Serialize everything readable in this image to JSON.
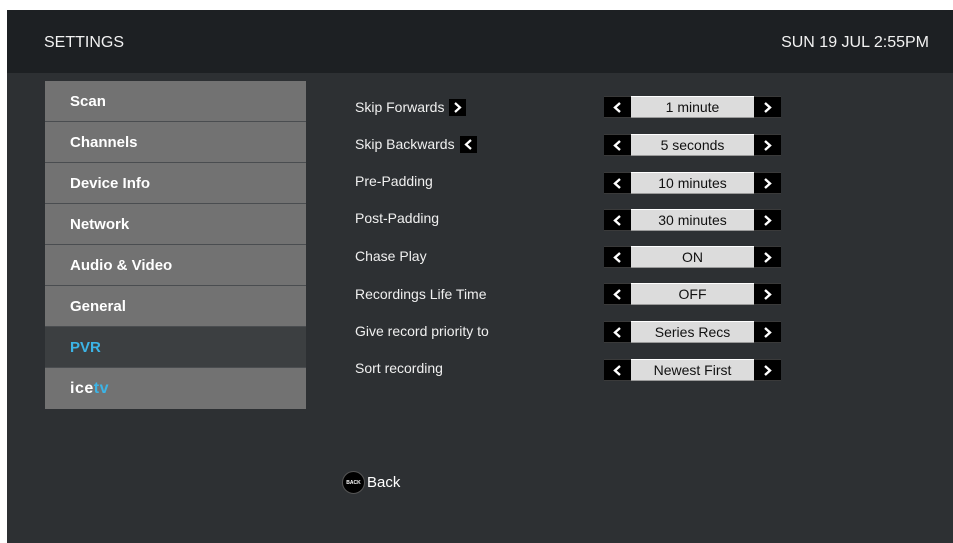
{
  "header": {
    "title": "SETTINGS",
    "datetime": "SUN 19 JUL 2:55PM"
  },
  "menu": {
    "items": [
      {
        "label": "Scan"
      },
      {
        "label": "Channels"
      },
      {
        "label": "Device Info"
      },
      {
        "label": "Network"
      },
      {
        "label": "Audio & Video"
      },
      {
        "label": "General"
      },
      {
        "label": "PVR",
        "active": true
      }
    ],
    "logo": {
      "part1": "ice",
      "part2": "tv"
    }
  },
  "settings": [
    {
      "label": "Skip Forwards",
      "key_icon": "chevron-right-icon",
      "value": "1 minute"
    },
    {
      "label": "Skip Backwards",
      "key_icon": "chevron-left-icon",
      "value": "5 seconds"
    },
    {
      "label": "Pre-Padding",
      "value": "10 minutes"
    },
    {
      "label": "Post-Padding",
      "value": "30 minutes"
    },
    {
      "label": "Chase Play",
      "value": "ON"
    },
    {
      "label": "Recordings Life Time",
      "value": "OFF"
    },
    {
      "label": "Give record priority to",
      "value": "Series Recs"
    },
    {
      "label": "Sort recording",
      "value": "Newest First"
    }
  ],
  "footer": {
    "back_badge": "BACK",
    "back_label": "Back"
  },
  "colors": {
    "accent": "#3cb4e6",
    "menu_bg": "#727272",
    "screen_bg": "#2d3033"
  }
}
